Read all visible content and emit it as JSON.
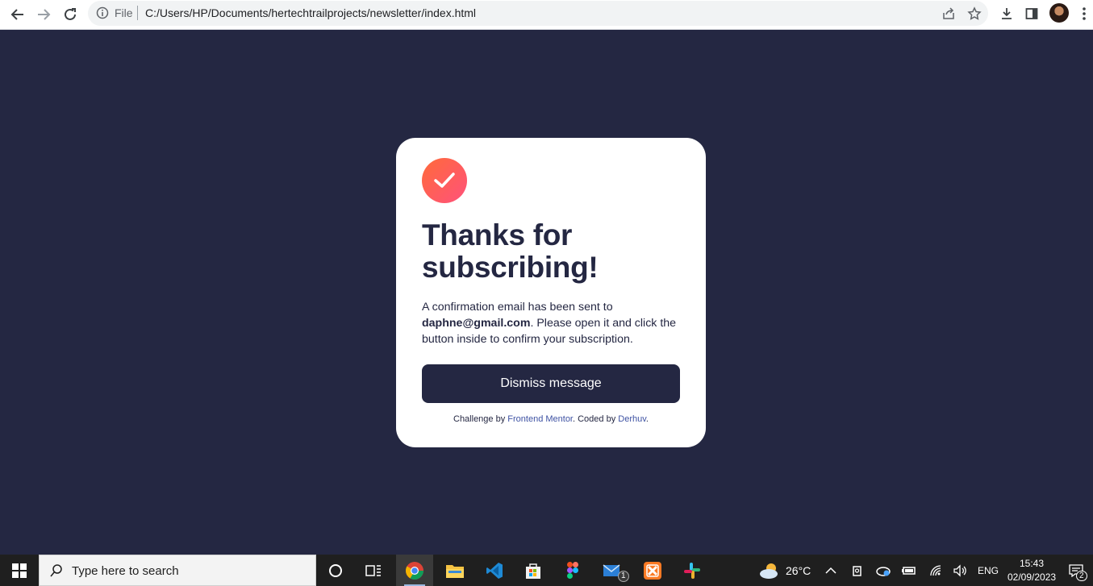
{
  "browser": {
    "scheme_label": "File",
    "url": "C:/Users/HP/Documents/hertechtrailprojects/newsletter/index.html"
  },
  "card": {
    "title_line1": "Thanks for",
    "title_line2": "subscribing!",
    "text_before": "A confirmation email has been sent to ",
    "email": "daphne@gmail.com",
    "text_after": ". Please open it and click the button inside to confirm your subscription.",
    "button_label": "Dismiss message",
    "attribution_prefix": "Challenge by ",
    "attribution_link1": "Frontend Mentor",
    "attribution_middle": ". Coded by ",
    "attribution_link2": "Derhuv",
    "attribution_suffix": "."
  },
  "colors": {
    "page_bg": "#242742",
    "accent_gradient_start": "#ff6a3a",
    "accent_gradient_end": "#ff527b",
    "text_dark": "#242742"
  },
  "taskbar": {
    "search_placeholder": "Type here to search",
    "apps": [
      "cortana-icon",
      "task-view-icon",
      "chrome-icon",
      "file-explorer-icon",
      "vscode-icon",
      "store-icon",
      "figma-icon",
      "mail-icon",
      "xampp-icon",
      "slack-icon"
    ],
    "mail_badge": "1",
    "weather_temp": "26°C",
    "language": "ENG",
    "time": "15:43",
    "date": "02/09/2023",
    "notification_count": "2"
  }
}
